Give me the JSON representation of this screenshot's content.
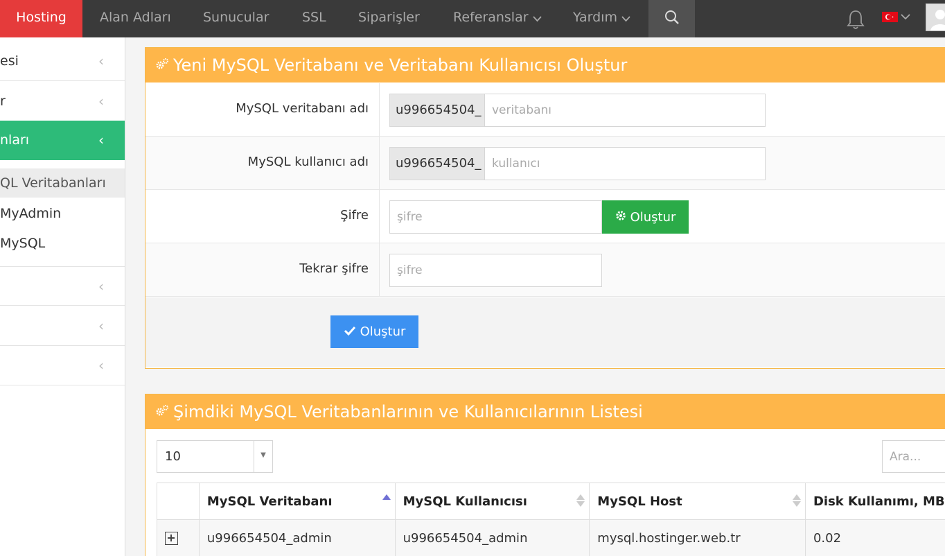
{
  "nav": {
    "hosting": "Hosting",
    "domains": "Alan Adları",
    "servers": "Sunucular",
    "ssl": "SSL",
    "orders": "Siparişler",
    "references": "Referanslar",
    "help": "Yardım",
    "accent_color": "#e53b3b",
    "flag_country": "Türkiye"
  },
  "sidebar": {
    "items": [
      {
        "label": "esi"
      },
      {
        "label": "r"
      },
      {
        "label": "nları"
      },
      {
        "label": ""
      },
      {
        "label": ""
      },
      {
        "label": ""
      }
    ],
    "sub_items": [
      {
        "label": "QL Veritabanları"
      },
      {
        "label": "MyAdmin"
      },
      {
        "label": " MySQL"
      }
    ],
    "active_color": "#2dbb79"
  },
  "create_panel": {
    "title": "Yeni MySQL Veritabanı ve Veritabanı Kullanıcısı Oluştur",
    "db_name_label": "MySQL veritabanı adı",
    "db_prefix": "u996654504_",
    "db_placeholder": "veritabanı",
    "user_label": "MySQL kullanıcı adı",
    "user_prefix": "u996654504_",
    "user_placeholder": "kullanıcı",
    "password_label": "Şifre",
    "password_placeholder": "şifre",
    "generate_button": "Oluştur",
    "repeat_password_label": "Tekrar şifre",
    "repeat_password_placeholder": "şifre",
    "submit_button": "Oluştur"
  },
  "list_panel": {
    "title": "Şimdiki MySQL Veritabanlarının ve Kullanıcılarının Listesi",
    "page_size": "10",
    "search_placeholder": "Ara...",
    "columns": [
      "MySQL Veritabanı",
      "MySQL Kullanıcısı",
      "MySQL Host",
      "Disk Kullanımı, MB"
    ],
    "rows": [
      {
        "database": "u996654504_admin",
        "user": "u996654504_admin",
        "host": "mysql.hostinger.web.tr",
        "disk": "0.02"
      }
    ]
  }
}
